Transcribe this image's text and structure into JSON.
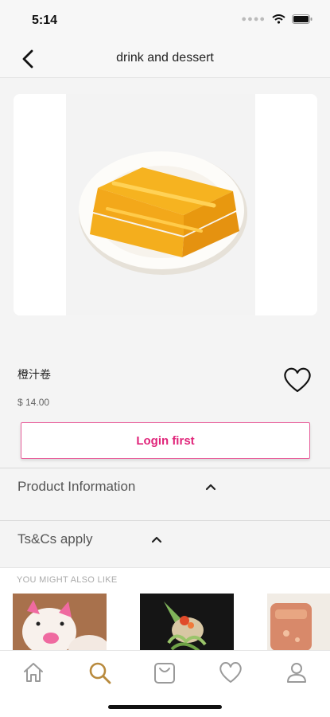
{
  "status": {
    "time": "5:14"
  },
  "nav": {
    "title": "drink and dessert"
  },
  "product": {
    "name": "橙汁卷",
    "price": "$ 14.00"
  },
  "actions": {
    "login_label": "Login first"
  },
  "sections": [
    {
      "label": "Product Information"
    },
    {
      "label": "Ts&Cs apply"
    }
  ],
  "recommendations": {
    "title": "YOU MIGHT ALSO LIKE"
  },
  "colors": {
    "accent": "#e0257a",
    "tab_active": "#b88a3d",
    "tab_inactive": "#9a9a9a"
  },
  "tabs": [
    {
      "icon": "home-icon",
      "active": false
    },
    {
      "icon": "search-icon",
      "active": true
    },
    {
      "icon": "bag-icon",
      "active": false
    },
    {
      "icon": "heart-icon",
      "active": false
    },
    {
      "icon": "profile-icon",
      "active": false
    }
  ]
}
